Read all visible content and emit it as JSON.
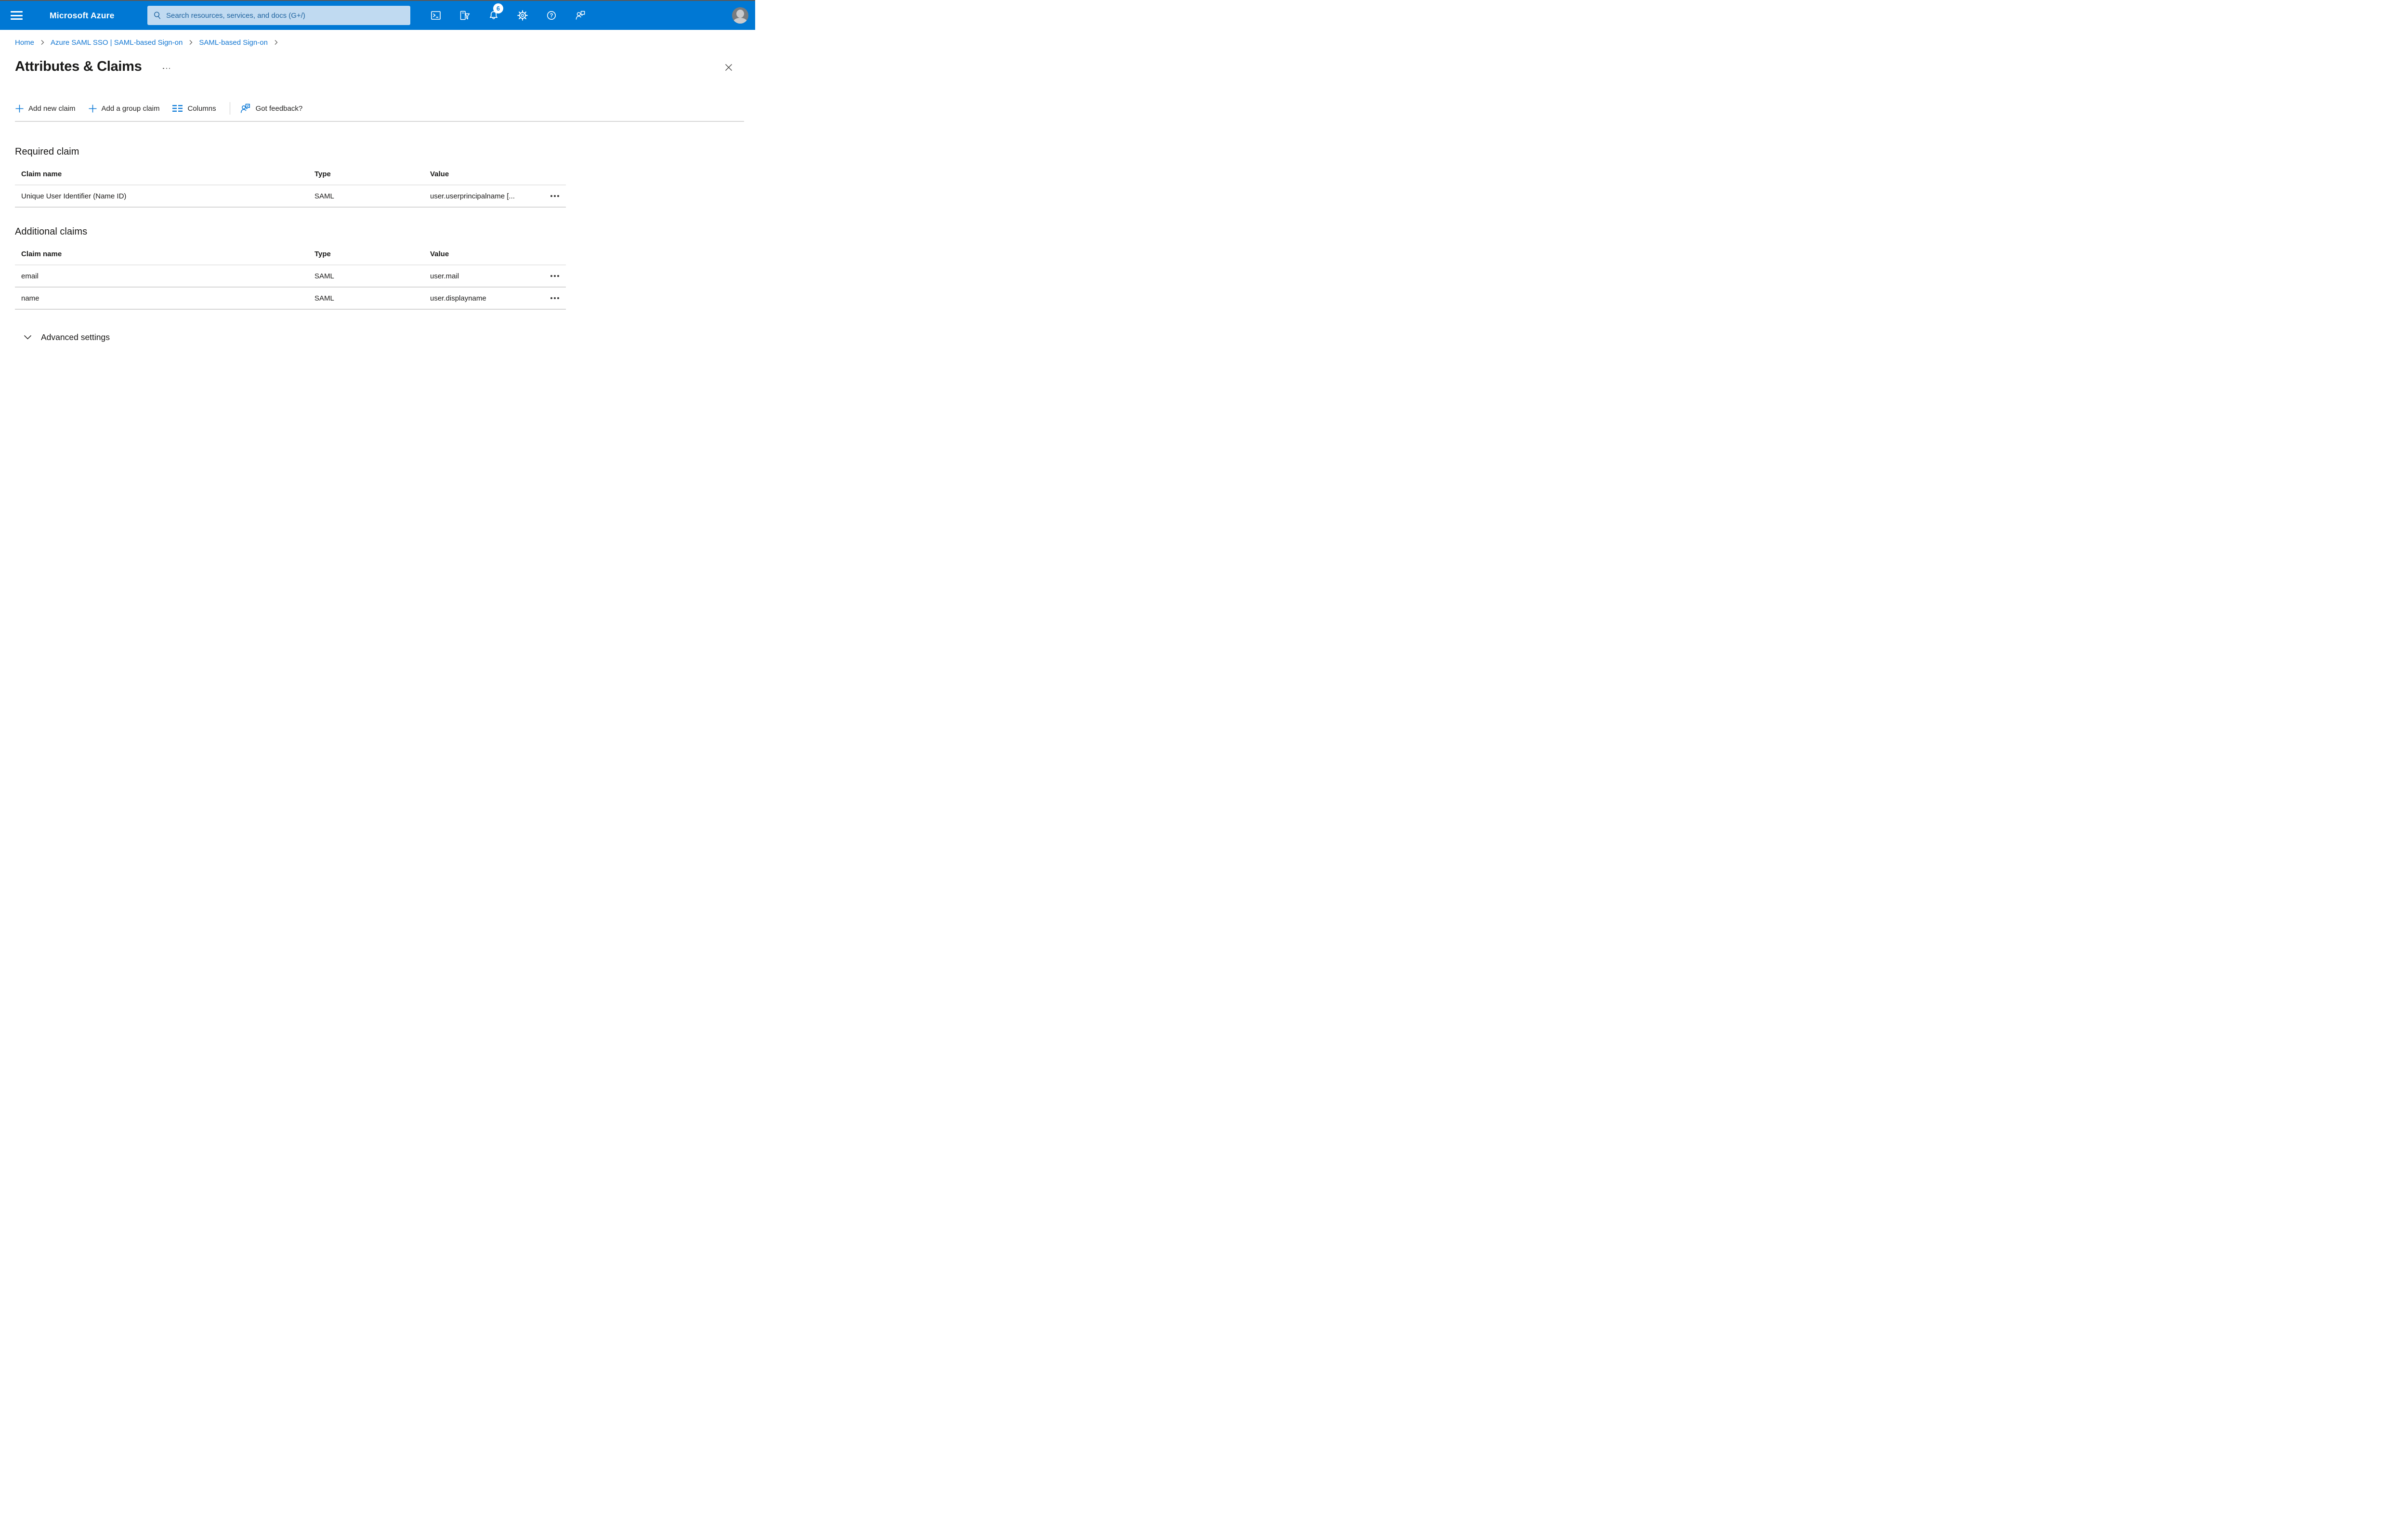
{
  "topbar": {
    "brand": "Microsoft Azure",
    "search_placeholder": "Search resources, services, and docs (G+/)",
    "notification_count": "6"
  },
  "breadcrumb": {
    "items": [
      {
        "label": "Home"
      },
      {
        "label": "Azure SAML SSO | SAML-based Sign-on"
      },
      {
        "label": "SAML-based Sign-on"
      }
    ]
  },
  "page": {
    "title": "Attributes & Claims"
  },
  "toolbar": {
    "add_new_claim": "Add new claim",
    "add_group_claim": "Add a group claim",
    "columns": "Columns",
    "feedback": "Got feedback?"
  },
  "sections": {
    "required": {
      "heading": "Required claim",
      "columns": [
        "Claim name",
        "Type",
        "Value"
      ],
      "rows": [
        {
          "name": "Unique User Identifier (Name ID)",
          "type": "SAML",
          "value": "user.userprincipalname [..."
        }
      ]
    },
    "additional": {
      "heading": "Additional claims",
      "columns": [
        "Claim name",
        "Type",
        "Value"
      ],
      "rows": [
        {
          "name": "email",
          "type": "SAML",
          "value": "user.mail"
        },
        {
          "name": "name",
          "type": "SAML",
          "value": "user.displayname"
        }
      ]
    }
  },
  "advanced": {
    "label": "Advanced settings"
  },
  "icons": {
    "hamburger": "menu",
    "search": "magnifier",
    "cloud_shell": "terminal-prompt",
    "directory_filter": "document-funnel",
    "notifications": "bell",
    "settings": "gear",
    "help": "question-circle",
    "feedback": "person-speech-bubble",
    "row_menu": "ellipsis",
    "breadcrumb_separator": "chevron-right",
    "add": "plus",
    "columns": "double-list",
    "advanced_chevron": "chevron-down",
    "close": "x",
    "avatar": "person-silhouette"
  },
  "colors": {
    "topbar": "#0078d4",
    "accent": "#0078d4",
    "search_bg": "#c0daf1",
    "search_text": "#1e639f",
    "row_divider": "#d6d6d6",
    "header_divider": "#e9e9e9"
  }
}
